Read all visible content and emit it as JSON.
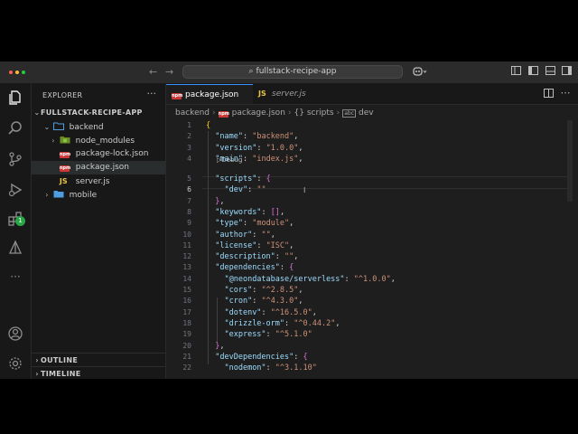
{
  "window": {
    "title": "fullstack-recipe-app",
    "traffic_lights": [
      "#ff5f57",
      "#febc2e",
      "#28c840"
    ]
  },
  "activity_bar": {
    "extensions_badge": "1",
    "icons": [
      "explorer-icon",
      "search-icon",
      "source-control-icon",
      "run-debug-icon",
      "extensions-icon",
      "remote-icon",
      "more-icon",
      "account-icon",
      "settings-gear-icon"
    ]
  },
  "sidebar": {
    "title": "EXPLORER",
    "more": "···",
    "root": "FULLSTACK-RECIPE-APP",
    "tree": [
      {
        "label": "backend",
        "kind": "folder-open",
        "depth": 1,
        "chevron": "⌄"
      },
      {
        "label": "node_modules",
        "kind": "folder-node",
        "depth": 2,
        "chevron": "›"
      },
      {
        "label": "package-lock.json",
        "kind": "npm",
        "depth": 2,
        "chevron": ""
      },
      {
        "label": "package.json",
        "kind": "npm",
        "depth": 2,
        "chevron": "",
        "selected": true
      },
      {
        "label": "server.js",
        "kind": "js",
        "depth": 2,
        "chevron": ""
      },
      {
        "label": "mobile",
        "kind": "folder",
        "depth": 1,
        "chevron": "›"
      }
    ],
    "outline": "OUTLINE",
    "timeline": "TIMELINE"
  },
  "tabs": [
    {
      "label": "package.json",
      "kind": "npm",
      "active": true
    },
    {
      "label": "server.js",
      "kind": "js",
      "active": false
    }
  ],
  "breadcrumb": {
    "folder": "backend",
    "file": "package.json",
    "section": "{} scripts",
    "key": "dev"
  },
  "code_lens": "Debug",
  "code": {
    "line_numbers": [
      "1",
      "2",
      "3",
      "4",
      "5",
      "6",
      "7",
      "8",
      "9",
      "10",
      "11",
      "12",
      "13",
      "14",
      "15",
      "16",
      "17",
      "18",
      "19",
      "20",
      "21",
      "22"
    ],
    "current_line": "6"
  },
  "colors": {
    "accent": "#3794ff",
    "key": "#9cdcfe",
    "string": "#ce9178",
    "npm_red": "#cb3837",
    "js_yellow": "#e8c547",
    "folder_blue": "#4d9de0"
  }
}
